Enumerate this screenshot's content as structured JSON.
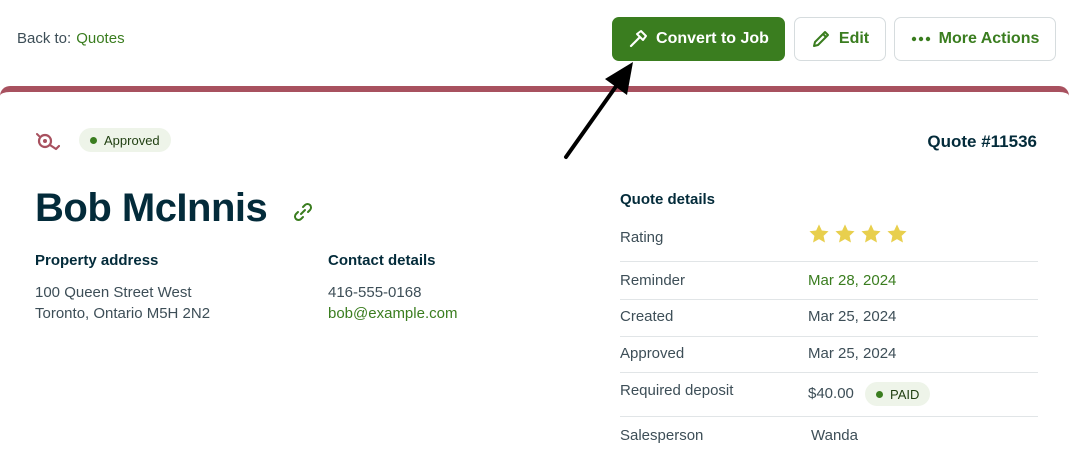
{
  "nav": {
    "back_prefix": "Back to:",
    "back_link": "Quotes"
  },
  "actions": {
    "convert_label": "Convert to Job",
    "edit_label": "Edit",
    "more_label": "More Actions"
  },
  "quote": {
    "status": "Approved",
    "number": "Quote #11536",
    "client_name": "Bob McInnis",
    "property_address_label": "Property address",
    "address_line1": "100 Queen Street West",
    "address_line2": "Toronto, Ontario M5H 2N2",
    "contact_label": "Contact details",
    "phone": "416-555-0168",
    "email": "bob@example.com"
  },
  "details": {
    "title": "Quote details",
    "rating_label": "Rating",
    "rating_stars": 4,
    "reminder_label": "Reminder",
    "reminder_value": "Mar 28, 2024",
    "created_label": "Created",
    "created_value": "Mar 25, 2024",
    "approved_label": "Approved",
    "approved_value": "Mar 25, 2024",
    "deposit_label": "Required deposit",
    "deposit_value": "$40.00",
    "deposit_status": "PAID",
    "salesperson_label": "Salesperson",
    "salesperson_value": "Wanda"
  },
  "colors": {
    "brand_green": "#3a7d1f",
    "quote_accent": "#a8515f",
    "star": "#e8cf4d",
    "text_dark": "#032b3a"
  },
  "icons": [
    "hammer-icon",
    "pencil-icon",
    "more-dots-icon",
    "quote-type-icon",
    "link-icon",
    "star-icon",
    "annotation-arrow"
  ]
}
